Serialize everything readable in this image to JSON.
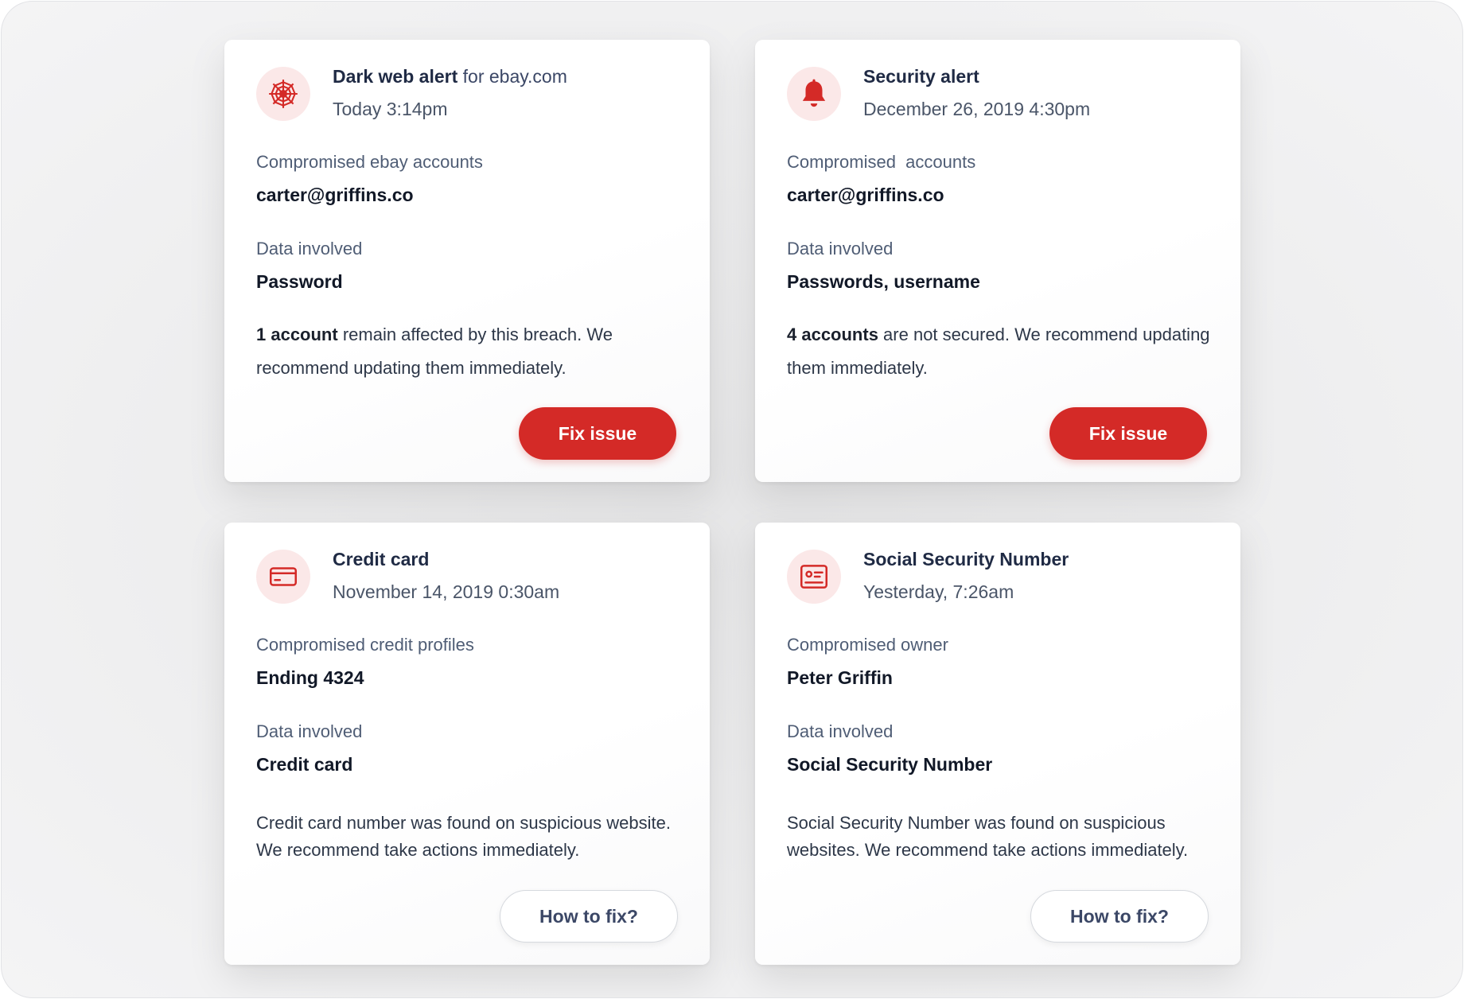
{
  "theme": {
    "accent": "#d42a27",
    "icon_bg": "#fbe8e8",
    "title_color": "#1f2a44"
  },
  "cards": [
    {
      "icon": "spider-web-icon",
      "title": "Dark web alert",
      "title_suffix": " for ebay.com",
      "time": "Today 3:14pm",
      "field1_label": "Compromised ebay accounts",
      "field1_value": "carter@griffins.co",
      "field2_label": "Data involved",
      "field2_value": "Password",
      "message_bold": "1 account",
      "message_rest": " remain affected by this breach. We recommend updating them immediately.",
      "button": "Fix issue"
    },
    {
      "icon": "bell-icon",
      "title": "Security alert",
      "time": "December 26, 2019 4:30pm",
      "field1_label": "Compromised  accounts",
      "field1_value": "carter@griffins.co",
      "field2_label": "Data involved",
      "field2_value": "Passwords, username",
      "message_bold": "4 accounts",
      "message_rest": " are not secured. We recommend updating them immediately.",
      "button": "Fix issue"
    },
    {
      "icon": "credit-card-icon",
      "title": "Credit card",
      "time": "November 14, 2019 0:30am",
      "field1_label": "Compromised credit profiles",
      "field1_value": "Ending 4324",
      "field2_label": "Data involved",
      "field2_value": "Credit card",
      "message": "Credit card number was found on suspicious website. We recommend take actions immediately.",
      "button": "How to fix?"
    },
    {
      "icon": "id-card-icon",
      "title": "Social Security Number",
      "time": "Yesterday, 7:26am",
      "field1_label": "Compromised owner",
      "field1_value": "Peter Griffin",
      "field2_label": "Data involved",
      "field2_value": "Social Security Number",
      "message": "Social Security Number was found on suspicious websites. We recommend take actions immediately.",
      "button": "How to fix?"
    }
  ]
}
